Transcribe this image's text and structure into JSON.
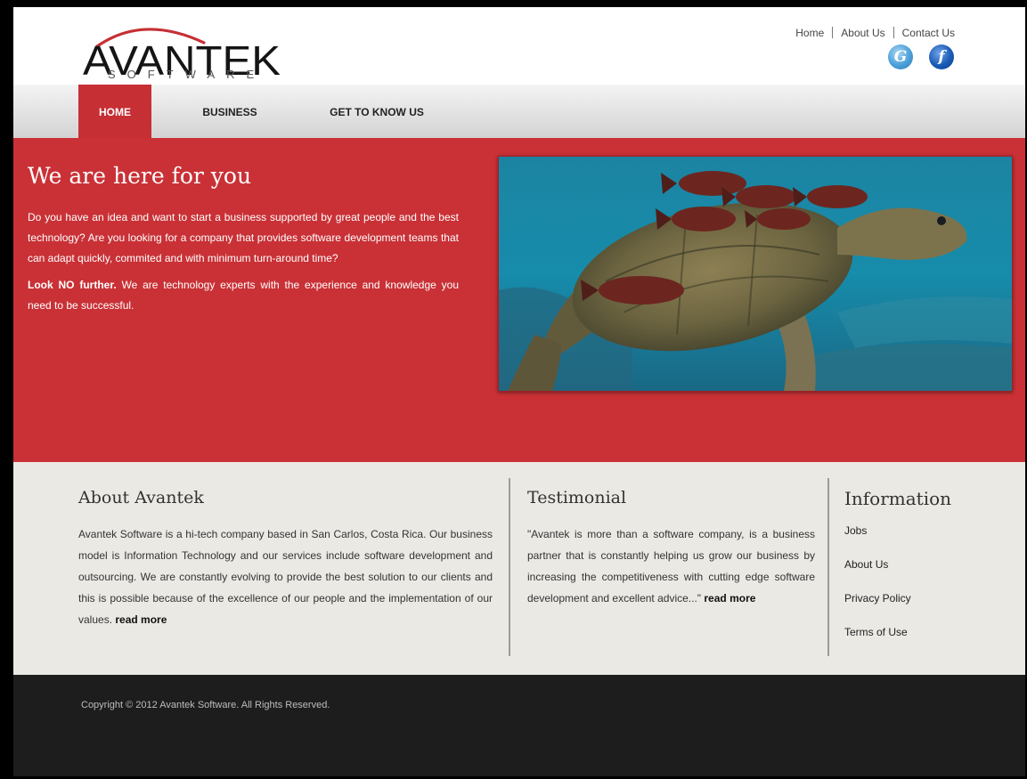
{
  "brand": {
    "logo_text": "AVANTEK",
    "logo_subtext": "SOFTWARE",
    "accent_color": "#c93136"
  },
  "top_links": {
    "home": "Home",
    "about": "About Us",
    "contact": "Contact Us"
  },
  "social": {
    "google_icon": "google-icon",
    "facebook_icon": "facebook-icon",
    "google_glyph": "G",
    "facebook_glyph": "f"
  },
  "nav": {
    "items": [
      {
        "label": "HOME",
        "active": true
      },
      {
        "label": "BUSINESS",
        "active": false
      },
      {
        "label": "GET TO KNOW US",
        "active": false
      }
    ]
  },
  "hero": {
    "title": "We are here for you",
    "paragraph1": "Do you have an idea and want to start a business supported by great people and the best technology? Are you looking for a company that provides software development teams that can adapt quickly, commited and with minimum turn-around time?",
    "paragraph2_bold": "Look NO further.",
    "paragraph2_rest": " We are technology experts with the experience and knowledge you need to be successful.",
    "slider": {
      "image_subject": "sea-turtle-with-fish",
      "dots": 3,
      "active_dot": 2
    }
  },
  "about": {
    "title": "About Avantek",
    "text": "Avantek Software is a hi-tech company based in San Carlos, Costa Rica. Our business model is Information Technology and our services include software development and outsourcing. We are constantly evolving to provide the best solution to our clients and this is possible because of the excellence of our people and the implementation of our values. ",
    "read_more": "read more"
  },
  "testimonial": {
    "title": "Testimonial",
    "text": "\"Avantek is more than a software company, is a business partner that is constantly helping us grow our business by increasing the competitiveness with cutting edge software development and excellent advice...\" ",
    "read_more": "read more"
  },
  "information": {
    "title": "Information",
    "links": [
      "Jobs",
      "About Us",
      "Privacy Policy",
      "Terms of Use"
    ]
  },
  "footer": {
    "copyright": "Copyright © 2012 Avantek Software. All Rights Reserved."
  }
}
